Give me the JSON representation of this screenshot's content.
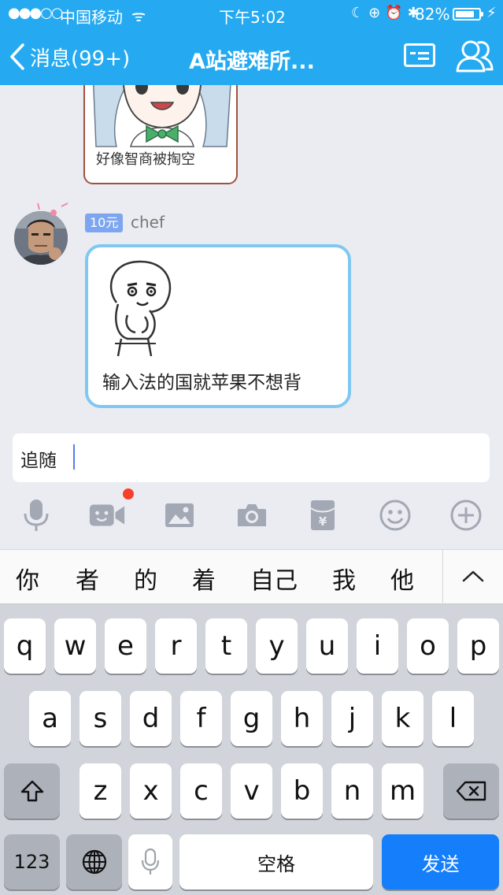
{
  "status_bar": {
    "signal": "●●●○○",
    "carrier": "中国移动",
    "wifi": "ᯤ",
    "time": "下午5:02",
    "icons": "☾⊕⏰✱",
    "battery_percent": "82%",
    "battery_level": 0.82,
    "charging": "⚡"
  },
  "nav": {
    "back_label": "消息(99+)",
    "title": "A站避难所...",
    "card_icon": "profile-card-icon",
    "members_icon": "group-members-icon"
  },
  "chat": {
    "previous_message": {
      "caption": "好像智商被掏空"
    },
    "message": {
      "badge": "10元",
      "sender": "chef",
      "text": "输入法的国就苹果不想背"
    }
  },
  "input": {
    "value": "追随"
  },
  "toolbar": [
    "microphone-icon",
    "video-call-icon",
    "image-icon",
    "camera-icon",
    "red-packet-icon",
    "emoji-icon",
    "plus-icon"
  ],
  "candidates": {
    "items": [
      "你",
      "者",
      "的",
      "着",
      "自己",
      "我",
      "他"
    ],
    "expand": "^"
  },
  "keyboard": {
    "row1": [
      "q",
      "w",
      "e",
      "r",
      "t",
      "y",
      "u",
      "i",
      "o",
      "p"
    ],
    "row2": [
      "a",
      "s",
      "d",
      "f",
      "g",
      "h",
      "j",
      "k",
      "l"
    ],
    "row3": [
      "z",
      "x",
      "c",
      "v",
      "b",
      "n",
      "m"
    ],
    "numbers": "123",
    "space": "空格",
    "send": "发送"
  },
  "colors": {
    "nav_bg": "#25aaf1",
    "bubble_border": "#80c8f2",
    "send_key": "#147efb",
    "badge_bg": "#7ea6f0"
  }
}
